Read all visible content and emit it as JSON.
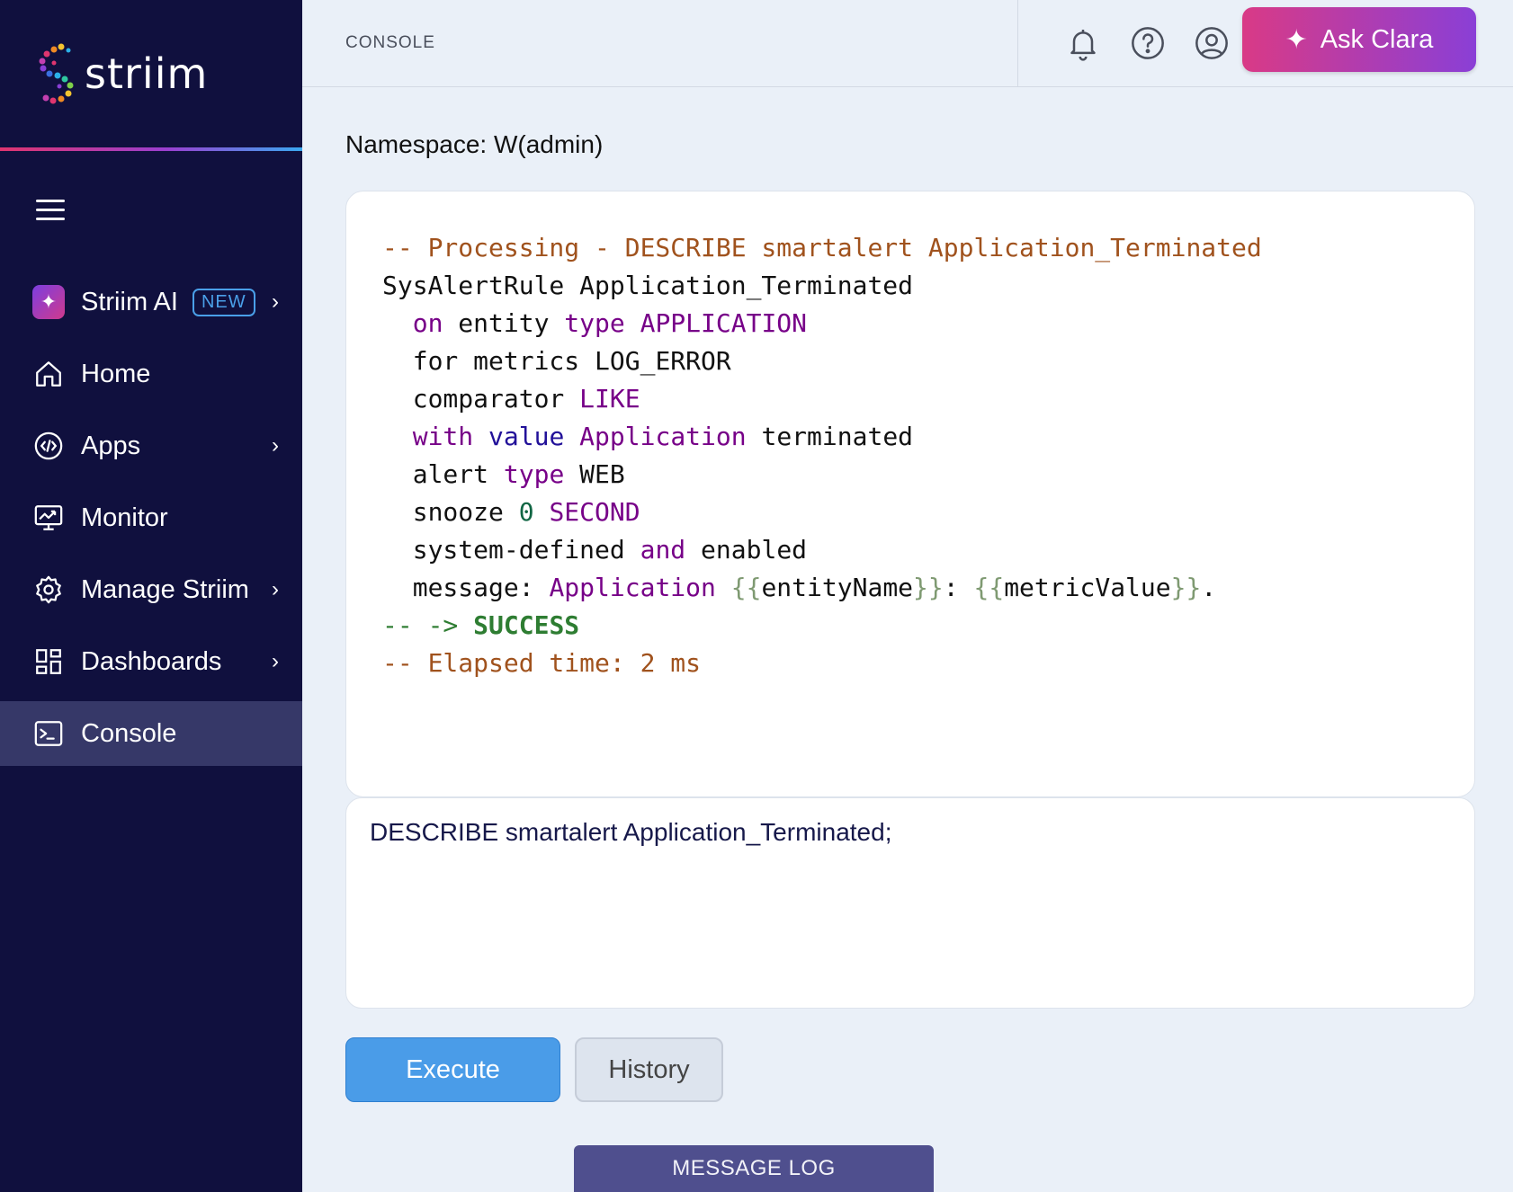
{
  "brand": {
    "name": "striim"
  },
  "sidebar": {
    "items": [
      {
        "label": "Striim AI",
        "badge": "NEW",
        "icon": "sparkle-icon",
        "chevron": "›"
      },
      {
        "label": "Home",
        "icon": "home-icon"
      },
      {
        "label": "Apps",
        "icon": "apps-icon",
        "chevron": "›"
      },
      {
        "label": "Monitor",
        "icon": "monitor-icon"
      },
      {
        "label": "Manage Striim",
        "icon": "gear-icon",
        "chevron": "›"
      },
      {
        "label": "Dashboards",
        "icon": "dashboards-icon",
        "chevron": "›"
      },
      {
        "label": "Console",
        "icon": "console-icon",
        "active": true
      }
    ]
  },
  "header": {
    "breadcrumb": "CONSOLE",
    "ask_button": "Ask Clara"
  },
  "main": {
    "namespace": "Namespace: W(admin)",
    "output": {
      "line1": "-- Processing - DESCRIBE smartalert Application_Terminated",
      "line2": "SysAlertRule Application_Terminated",
      "l3a": "on",
      "l3b": " entity ",
      "l3c": "type",
      "l3d": " APPLICATION",
      "l4": "for metrics LOG_ERROR",
      "l5a": "comparator ",
      "l5b": "LIKE",
      "l6a": "with",
      "l6b": "value",
      "l6c": "Application",
      "l6d": " terminated",
      "l7a": "alert ",
      "l7b": "type",
      "l7c": " WEB",
      "l8a": "snooze ",
      "l8b": "0",
      "l8c": "SECOND",
      "l9a": "system-defined ",
      "l9b": "and",
      "l9c": " enabled",
      "l10a": "message: ",
      "l10b": "Application",
      "l10c": "{{",
      "l10d": "entityName",
      "l10e": "}}",
      "l10f": ": ",
      "l10g": "{{",
      "l10h": "metricValue",
      "l10i": "}}",
      "l10j": ".",
      "l11a": "-- -> ",
      "l11b": "SUCCESS",
      "line12": "-- Elapsed time: 2 ms"
    },
    "input_value": "DESCRIBE smartalert Application_Terminated;",
    "execute_label": "Execute",
    "history_label": "History",
    "message_log_label": "MESSAGE LOG"
  },
  "colors": {
    "sidebar_bg": "#10103e",
    "accent_blue": "#4a9ce8",
    "ask_gradient_start": "#d93a86",
    "ask_gradient_end": "#8a3fd6"
  }
}
